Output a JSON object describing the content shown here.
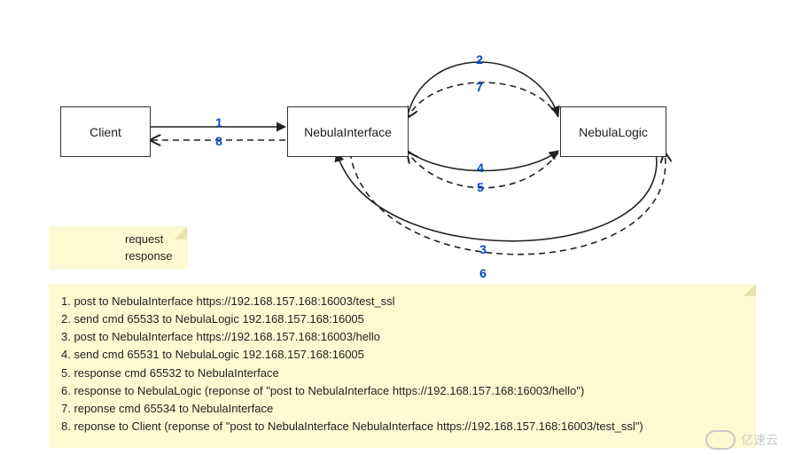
{
  "diagram": {
    "type": "sequence-flow",
    "nodes": {
      "client": {
        "label": "Client"
      },
      "interface": {
        "label": "NebulaInterface"
      },
      "logic": {
        "label": "NebulaLogic"
      }
    },
    "edges": [
      {
        "id": 1,
        "from": "client",
        "to": "interface",
        "kind": "request"
      },
      {
        "id": 2,
        "from": "interface",
        "to": "logic",
        "kind": "request"
      },
      {
        "id": 3,
        "from": "logic",
        "to": "interface",
        "kind": "request"
      },
      {
        "id": 4,
        "from": "interface",
        "to": "logic",
        "kind": "request"
      },
      {
        "id": 5,
        "from": "logic",
        "to": "interface",
        "kind": "response"
      },
      {
        "id": 6,
        "from": "interface",
        "to": "logic",
        "kind": "response"
      },
      {
        "id": 7,
        "from": "logic",
        "to": "interface",
        "kind": "response"
      },
      {
        "id": 8,
        "from": "interface",
        "to": "client",
        "kind": "response"
      }
    ],
    "legend": {
      "request": "request",
      "response": "response"
    },
    "steps": [
      "1. post to NebulaInterface https://192.168.157.168:16003/test_ssl",
      "2. send cmd 65533 to  NebulaLogic 192.168.157.168:16005",
      "3. post to NebulaInterface https://192.168.157.168:16003/hello",
      "4. send cmd 65531 to  NebulaLogic 192.168.157.168:16005",
      "5. response cmd 65532 to NebulaInterface",
      "6. response to NebulaLogic (reponse of \"post to NebulaInterface https://192.168.157.168:16003/hello\")",
      "7. reponse cmd 65534 to NebulaInterface",
      "8. reponse to Client (reponse of \"post to NebulaInterface NebulaInterface https://192.168.157.168:16003/test_ssl\")"
    ],
    "colors": {
      "edge_label": "#0048c8",
      "note_bg": "#fdfad3"
    }
  },
  "watermark": {
    "text": "亿速云"
  }
}
